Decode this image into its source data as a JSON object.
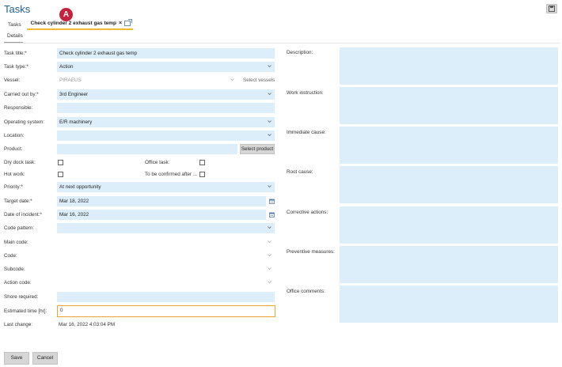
{
  "app": {
    "title": "Tasks"
  },
  "tabs": {
    "home": "Tasks",
    "active": "Check cylinder 2 exhaust gas temp",
    "close_glyph": "×"
  },
  "marker": "A",
  "subtab": "Details",
  "form": {
    "task_title": {
      "label": "Task title:*",
      "value": "Check cylinder 2 exhaust gas temp"
    },
    "task_type": {
      "label": "Task type:*",
      "value": "Action"
    },
    "vessel": {
      "label": "Vessel:",
      "value": "PIRAEUS",
      "select_label": "Select vessels"
    },
    "carried_out_by": {
      "label": "Carried out by:*",
      "value": "3rd Engineer"
    },
    "responsible": {
      "label": "Responsible:",
      "value": ""
    },
    "operating_system": {
      "label": "Operating system:",
      "value": "E/R machinery"
    },
    "location": {
      "label": "Location:",
      "value": ""
    },
    "product": {
      "label": "Product:",
      "value": "",
      "button": "Select product"
    },
    "dry_dock_task": {
      "label": "Dry dock task:",
      "checked": false
    },
    "office_task": {
      "label": "Office task:",
      "checked": false
    },
    "hot_work": {
      "label": "Hot work:",
      "checked": false
    },
    "to_be_confirmed": {
      "label": "To be confirmed after ...",
      "checked": false
    },
    "priority": {
      "label": "Priority:*",
      "value": "At next opportunity"
    },
    "target_date": {
      "label": "Target date:*",
      "value": "Mar 18, 2022"
    },
    "date_of_incident": {
      "label": "Date of incident:*",
      "value": "Mar 16, 2022"
    },
    "code_pattern": {
      "label": "Code pattern:",
      "value": ""
    },
    "main_code": {
      "label": "Main code:",
      "value": ""
    },
    "code": {
      "label": "Code:",
      "value": ""
    },
    "subcode": {
      "label": "Subcode:",
      "value": ""
    },
    "action_code": {
      "label": "Action code:",
      "value": ""
    },
    "shore_required": {
      "label": "Shore required:",
      "value": ""
    },
    "estimated_time": {
      "label": "Estimated time [hr]:",
      "value": "0"
    },
    "last_change": {
      "label": "Last change:",
      "value": "Mar 16, 2022 4:03:04 PM"
    }
  },
  "right": {
    "description": "Description:",
    "work_instruction": "Work instruction:",
    "immediate_cause": "Immediate cause:",
    "root_cause": "Root cause:",
    "corrective_actions": "Corrective actions:",
    "preventive_measures": "Preventive measures:",
    "office_comments": "Office comments:"
  },
  "footer": {
    "save": "Save",
    "cancel": "Cancel"
  },
  "colors": {
    "accent": "#f2b733",
    "field_bg": "#ddeefb",
    "title": "#1f5f8b",
    "marker": "#c5213c"
  }
}
